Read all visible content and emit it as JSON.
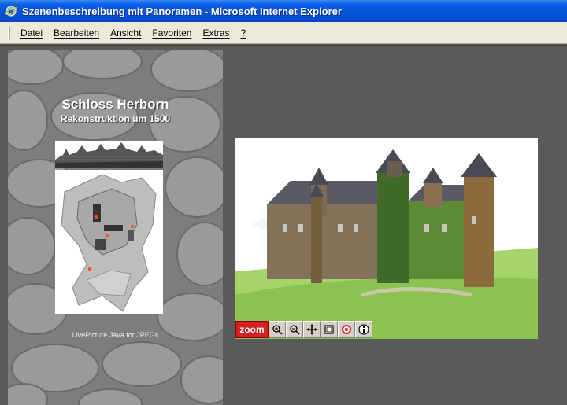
{
  "window": {
    "title": "Szenenbeschreibung mit Panoramen - Microsoft Internet Explorer"
  },
  "menubar": {
    "items": [
      {
        "label": "Datei"
      },
      {
        "label": "Bearbeiten"
      },
      {
        "label": "Ansicht"
      },
      {
        "label": "Favoriten"
      },
      {
        "label": "Extras"
      },
      {
        "label": "?"
      }
    ]
  },
  "left_panel": {
    "title": "Schloss Herborn",
    "subtitle": "Rekonstruktion um 1500",
    "caption": "LivePicture Java for JPEGs"
  },
  "viewer_toolbar": {
    "zoom_label": "zoom",
    "tools": [
      "zoom-in-icon",
      "zoom-out-icon",
      "pan-icon",
      "page-icon",
      "target-icon",
      "info-icon"
    ]
  },
  "colors": {
    "titlebar": "#0553d8",
    "menubar": "#ece9d8",
    "background": "#5a5a5a",
    "zoom_button": "#d42020"
  }
}
